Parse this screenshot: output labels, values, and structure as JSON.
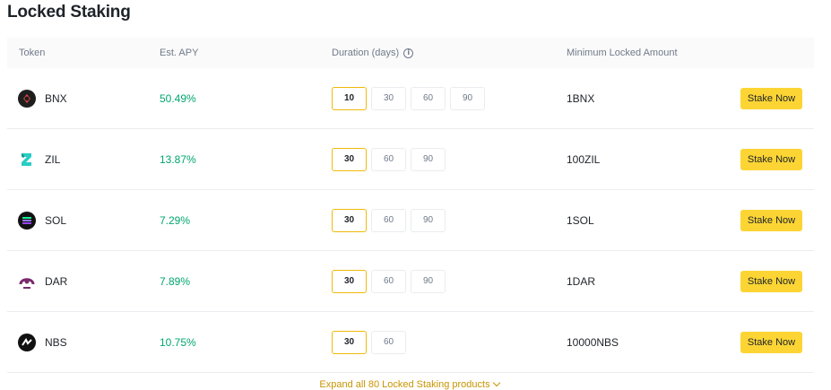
{
  "page": {
    "title": "Locked Staking"
  },
  "table": {
    "headers": {
      "token": "Token",
      "apy": "Est. APY",
      "duration": "Duration (days)",
      "min_amount": "Minimum Locked Amount"
    },
    "rows": [
      {
        "token": "BNX",
        "icon": "bnx-coin-icon",
        "apy": "50.49%",
        "durations": [
          "10",
          "30",
          "60",
          "90"
        ],
        "selected": 0,
        "min_amount": "1BNX",
        "action": "Stake Now"
      },
      {
        "token": "ZIL",
        "icon": "zil-coin-icon",
        "apy": "13.87%",
        "durations": [
          "30",
          "60",
          "90"
        ],
        "selected": 0,
        "min_amount": "100ZIL",
        "action": "Stake Now"
      },
      {
        "token": "SOL",
        "icon": "sol-coin-icon",
        "apy": "7.29%",
        "durations": [
          "30",
          "60",
          "90"
        ],
        "selected": 0,
        "min_amount": "1SOL",
        "action": "Stake Now"
      },
      {
        "token": "DAR",
        "icon": "dar-coin-icon",
        "apy": "7.89%",
        "durations": [
          "30",
          "60",
          "90"
        ],
        "selected": 0,
        "min_amount": "1DAR",
        "action": "Stake Now"
      },
      {
        "token": "NBS",
        "icon": "nbs-coin-icon",
        "apy": "10.75%",
        "durations": [
          "30",
          "60"
        ],
        "selected": 0,
        "min_amount": "10000NBS",
        "action": "Stake Now"
      }
    ]
  },
  "footer": {
    "expand_label": "Expand all 80 Locked Staking products"
  },
  "colors": {
    "accent": "#fcd535",
    "positive": "#03a66d",
    "link": "#c99400"
  }
}
